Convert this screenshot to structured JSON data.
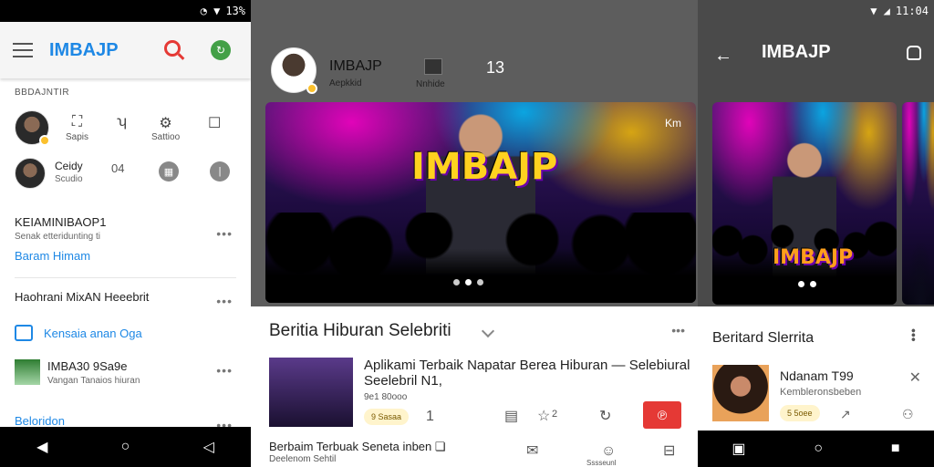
{
  "panel1": {
    "status": {
      "signal": "◔ ▼",
      "battery": "13%"
    },
    "brand": "IMBAJP",
    "section_label": "BBDAJNTIR",
    "row1": {
      "actions": [
        {
          "icon": "share-icon",
          "glyph": "⛶",
          "label": "Sapis"
        },
        {
          "icon": "comment-icon",
          "glyph": "ʮ",
          "label": ""
        },
        {
          "icon": "settings-icon",
          "glyph": "⚙",
          "label": "Sattioo"
        },
        {
          "icon": "square-icon",
          "glyph": "☐",
          "label": ""
        }
      ]
    },
    "row2": {
      "name": "Ceidy",
      "sub": "Scudio",
      "count": "04"
    },
    "item1": {
      "title": "KEIAMINIBAOP1",
      "sub": "Senak etteridunting ti",
      "link": "Baram Himam"
    },
    "item2": {
      "title": "Haohrani MixAN Heeebrit",
      "link": "Kensaia anan Oga"
    },
    "item3": {
      "title": "IMBA30 9Sa9e",
      "sub": "Vangan Tanaios hiuran"
    },
    "item4": {
      "title": "Beloridon"
    },
    "navbar": [
      "◀",
      "○",
      "◁"
    ]
  },
  "panel2": {
    "header": {
      "title": "IMBAJP",
      "subtitle": "Aepkkid",
      "image_label": "Nnhide",
      "count": "13"
    },
    "hero": {
      "text": "IMBAJP",
      "corner": "Km"
    },
    "feed": {
      "title": "Beritia Hiburan Selebriti",
      "article": {
        "title": "Aplikami Terbaik Napatar Berea Hiburan — Selebiural Seelebril N1,",
        "meta": "9e1 80ooo",
        "pill": "9 Sasaa",
        "count": "1",
        "stat": "2"
      },
      "second": {
        "title": "Berbaim Terbuak Seneta inben ❏",
        "sub": "Deelenom Sehtil"
      },
      "bottom_label": "Sssseunl"
    }
  },
  "panel3": {
    "status": {
      "time": "11:04"
    },
    "brand": "IMBAJP",
    "hero": {
      "text": "IMBAJP"
    },
    "feed": {
      "title": "Beritard Slerrita",
      "article": {
        "title": "Ndanam T99",
        "sub": "Kembleronsbeben",
        "pill": "5 5oee"
      }
    },
    "navbar": [
      "▣",
      "○",
      "■"
    ]
  }
}
